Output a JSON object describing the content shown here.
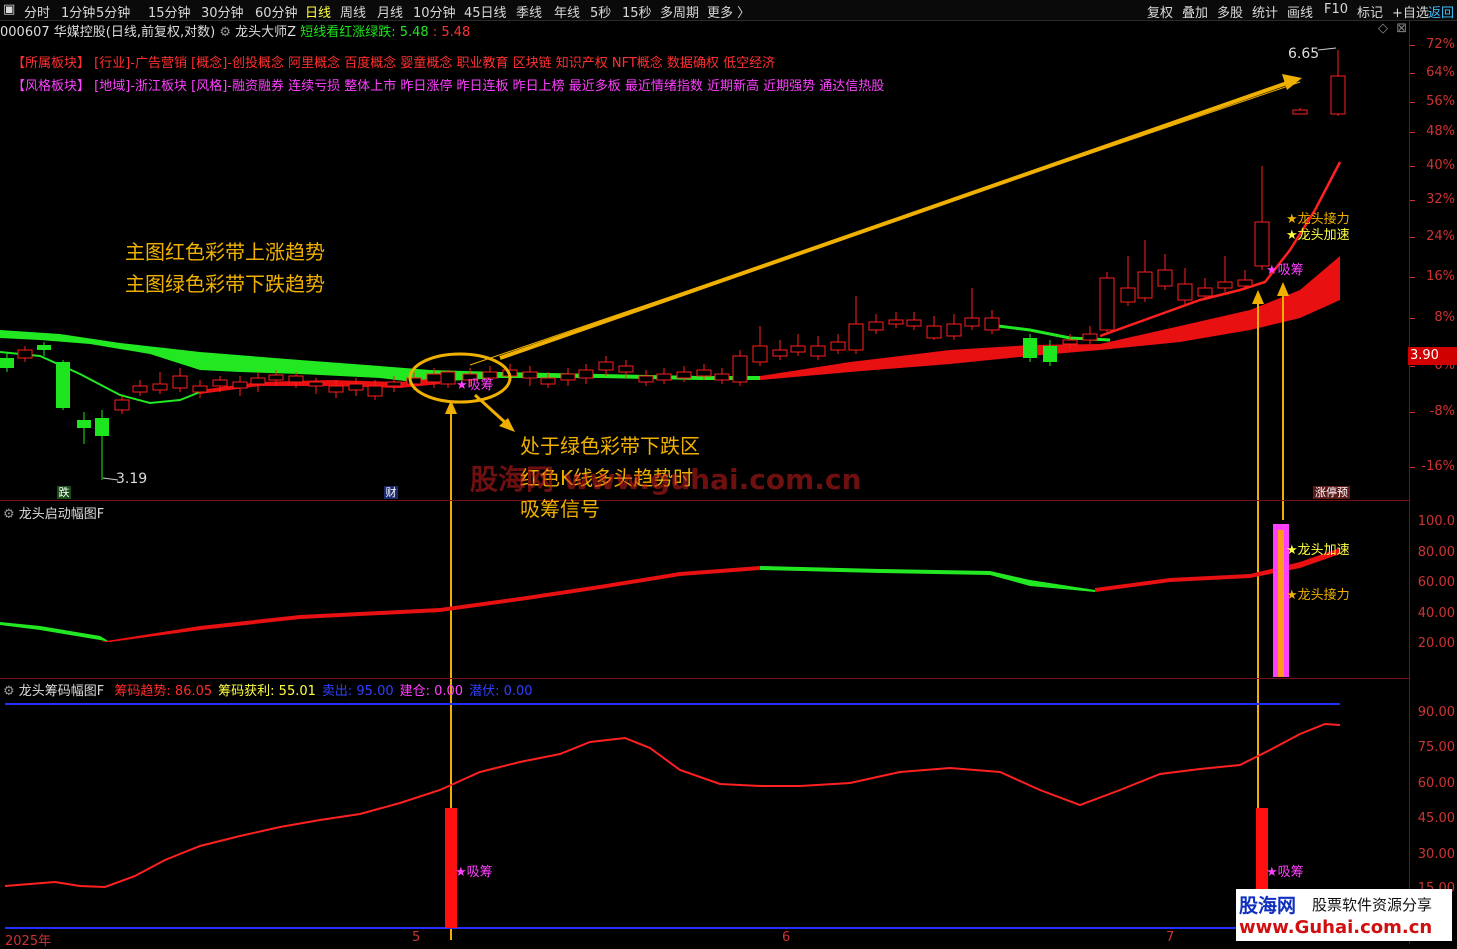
{
  "toolbar": {
    "left": [
      "分时",
      "1分钟",
      "5分钟",
      "15分钟",
      "30分钟",
      "60分钟",
      "日线",
      "周线",
      "月线",
      "10分钟",
      "45日线",
      "季线",
      "年线",
      "5秒",
      "15秒",
      "多周期",
      "更多 〉"
    ],
    "right": [
      "复权",
      "叠加",
      "多股",
      "统计",
      "画线",
      "F10",
      "标记",
      "+自选",
      "返回"
    ]
  },
  "stock": {
    "code": "000607",
    "name": "华媒控股",
    "mode": "(日线,前复权,对数)",
    "indicator": "龙头大师Z",
    "hint": "短线看红涨绿跌:",
    "val1": "5.48",
    "val2": "5.48"
  },
  "sector": {
    "label": "【所属板块】",
    "items": "[行业]-广告营销 [概念]-创投概念 阿里概念 百度概念 婴童概念 职业教育 区块链 知识产权 NFT概念 数据确权 低空经济"
  },
  "style": {
    "label": "【风格板块】",
    "items": "[地域]-浙江板块 [风格]-融资融券 连续亏损 整体上市 昨日涨停 昨日连板 昨日上榜 最近多板 最近情绪指数 近期新高 近期强势 通达信热股"
  },
  "price_axis": [
    "72%",
    "64%",
    "56%",
    "48%",
    "40%",
    "32%",
    "24%",
    "16%",
    "8%",
    "0%",
    "-8%",
    "-16%"
  ],
  "current_price": "3.90",
  "high_label": "6.65",
  "low_label": "3.19",
  "annotations": {
    "line1": "主图红色彩带上涨趋势",
    "line2": "主图绿色彩带下跌趋势",
    "note1": "处于绿色彩带下跌区",
    "note2": "红色K线多头趋势时",
    "note3": "吸筹信号"
  },
  "signals": {
    "xichou": "★吸筹",
    "jieli": "★龙头接力",
    "jiasu": "★龙头加速"
  },
  "markers": {
    "die": "跌",
    "cai": "财",
    "zhangting": "涨停预"
  },
  "panel2": {
    "title": "龙头启动幅图F",
    "axis": [
      "100.0",
      "80.00",
      "60.00",
      "40.00",
      "20.00"
    ]
  },
  "panel3": {
    "title": "龙头筹码幅图F",
    "items": [
      {
        "label": "筹码趋势:",
        "value": "86.05",
        "color": "#ff2a2a"
      },
      {
        "label": "筹码获利:",
        "value": "55.01",
        "color": "#ffff40"
      },
      {
        "label": "卖出:",
        "value": "95.00",
        "color": "#3040ff"
      },
      {
        "label": "建仓:",
        "value": "0.00",
        "color": "#ff40ff"
      },
      {
        "label": "潜伏:",
        "value": "0.00",
        "color": "#3040ff"
      }
    ],
    "axis": [
      "90.00",
      "75.00",
      "60.00",
      "45.00",
      "30.00",
      "15.00"
    ]
  },
  "dates": [
    "2025年",
    "5",
    "6",
    "7"
  ],
  "watermark": "股海网  www.guhai.com.cn",
  "brand": {
    "name": "股海网",
    "slogan": "股票软件资源分享",
    "url": "www.Guhai.com.cn"
  },
  "colors": {
    "up": "#ff2020",
    "down": "#1ee61e",
    "accent": "#f0b000",
    "signal": "#ff40ff"
  }
}
